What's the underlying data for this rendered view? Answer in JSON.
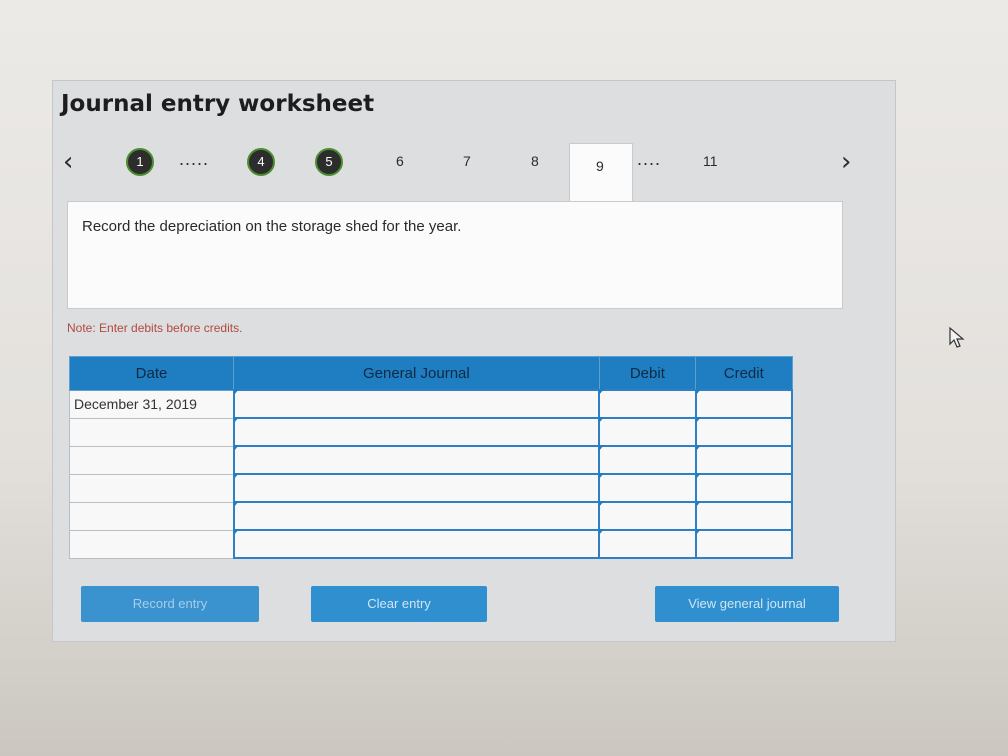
{
  "worksheet": {
    "title": "Journal entry worksheet",
    "stepper": {
      "prev_icon": "chevron-left-icon",
      "next_icon": "chevron-right-icon",
      "steps": [
        "1",
        "4",
        "5",
        "6",
        "7",
        "8",
        "9",
        "11"
      ],
      "current_step": "9",
      "ellipsis": "....."
    },
    "question": "Record the depreciation on the storage shed for the year.",
    "note": "Note: Enter debits before credits.",
    "table": {
      "headers": [
        "Date",
        "General Journal",
        "Debit",
        "Credit"
      ],
      "rows": [
        {
          "date": "December 31, 2019",
          "account": "",
          "debit": "",
          "credit": ""
        },
        {
          "date": "",
          "account": "",
          "debit": "",
          "credit": ""
        },
        {
          "date": "",
          "account": "",
          "debit": "",
          "credit": ""
        },
        {
          "date": "",
          "account": "",
          "debit": "",
          "credit": ""
        },
        {
          "date": "",
          "account": "",
          "debit": "",
          "credit": ""
        },
        {
          "date": "",
          "account": "",
          "debit": "",
          "credit": ""
        }
      ]
    },
    "buttons": {
      "record": "Record entry",
      "clear": "Clear entry",
      "view": "View general journal"
    },
    "colors": {
      "accent": "#1f7ec1",
      "button": "#2f8fcf",
      "note_text": "#b24a40",
      "completed_ring": "#4a8f2c"
    }
  }
}
